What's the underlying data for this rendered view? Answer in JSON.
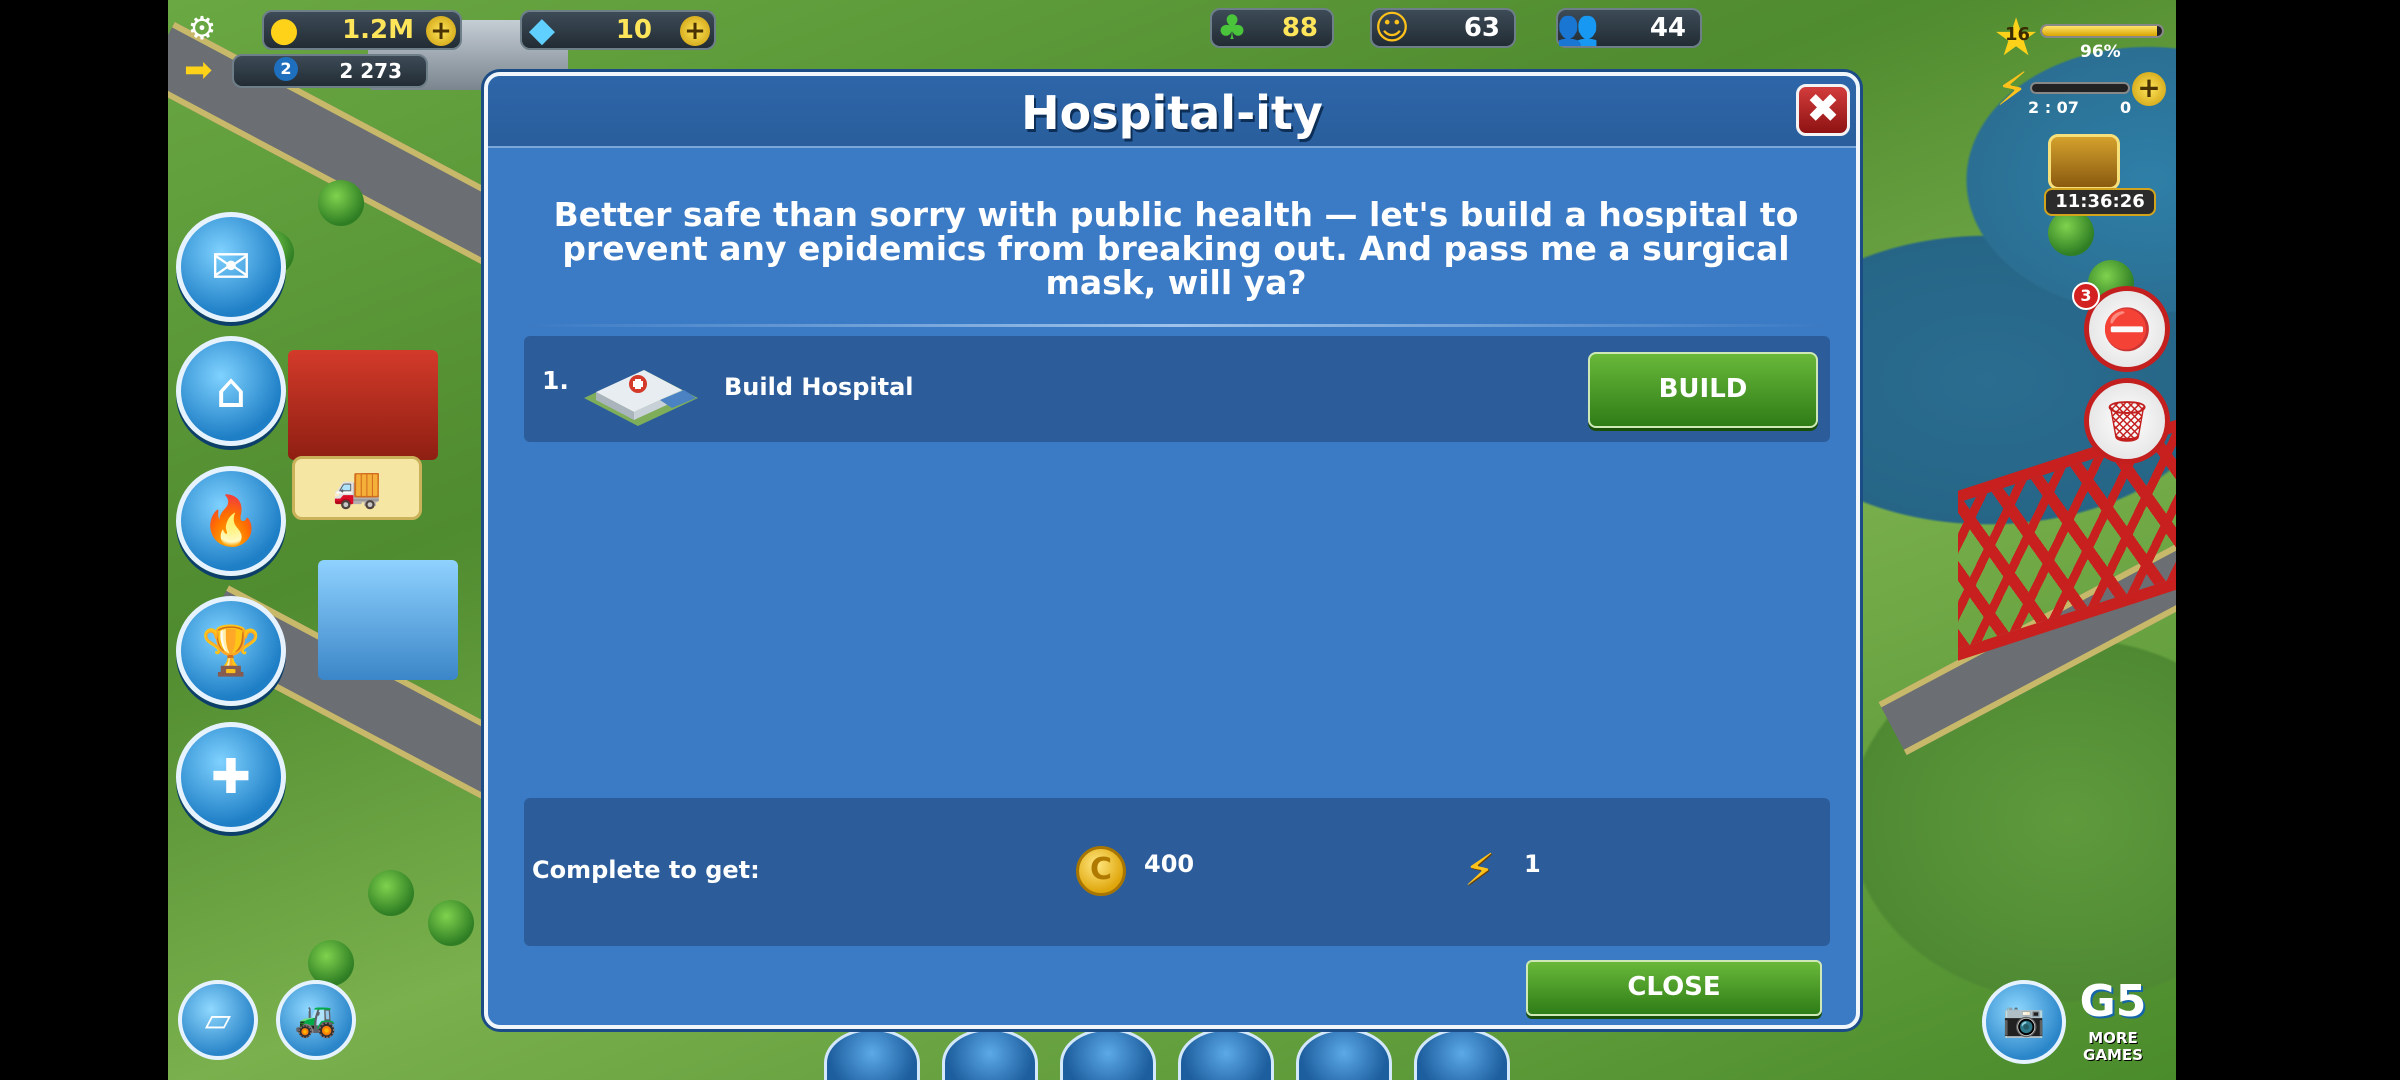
{
  "hud": {
    "coins": "1.2M",
    "gems": "10",
    "cash_count": "2 273",
    "cars_badge": "2",
    "eco": "88",
    "happiness": "63",
    "population": "44",
    "level": "16",
    "xp_percent_label": "96%",
    "xp_fraction": 0.96,
    "energy_timer": "2 : 07",
    "energy_value": "0",
    "chest_timer": "11:36:26",
    "side_badge": "3",
    "plus_symbol": "+"
  },
  "dialog": {
    "title": "Hospital-ity",
    "close_x": "✖",
    "description": "Better safe than sorry with public health — let's build a hospital to prevent any epidemics from breaking out. And pass me a surgical mask, will ya?",
    "task": {
      "number": "1.",
      "label": "Build Hospital",
      "button": "BUILD"
    },
    "reward": {
      "label": "Complete to get:",
      "coins": "400",
      "energy": "1"
    },
    "close_button": "CLOSE"
  },
  "corner": {
    "brand_line1": "MORE",
    "brand_line2": "GAMES"
  },
  "icons": {
    "settings": "gear-icon",
    "coin": "coin-icon",
    "gem": "gem-icon",
    "eco": "tree-icon",
    "happiness": "smiley-icon",
    "population": "people-icon",
    "level": "star-icon",
    "energy": "lightning-icon",
    "chest": "treasure-chest-icon",
    "camera": "camera-icon"
  },
  "colors": {
    "dialog_bg": "#3b7ac4",
    "button_green": "#3f9424",
    "close_red": "#b02020"
  }
}
